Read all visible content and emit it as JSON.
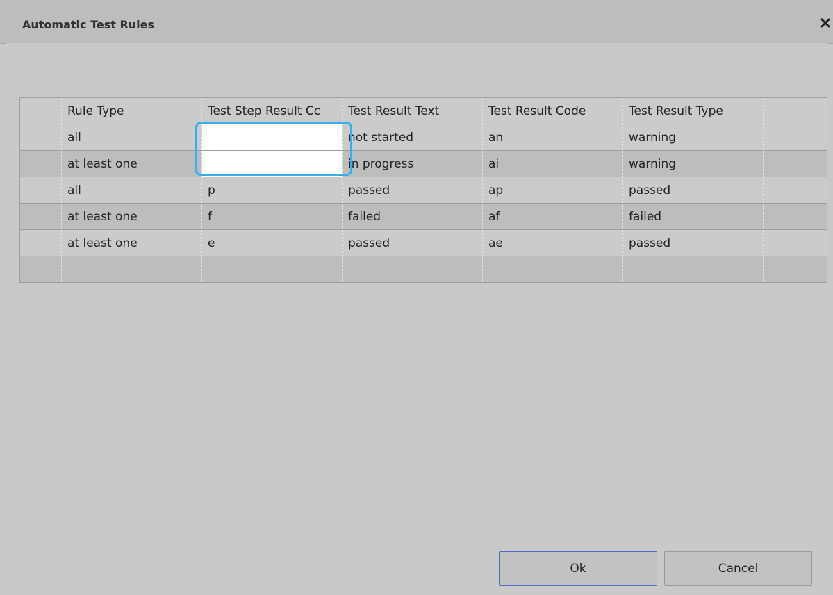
{
  "dialog": {
    "title": "Automatic Test Rules",
    "close_icon": "close-icon"
  },
  "table": {
    "columns": [
      "",
      "Rule Type",
      "Test Step Result Cc",
      "Test Result Text",
      "Test Result Code",
      "Test Result Type",
      ""
    ],
    "rows": [
      [
        "",
        "all",
        "",
        "not started",
        "an",
        "warning",
        ""
      ],
      [
        "",
        "at least one",
        "",
        "in progress",
        "ai",
        "warning",
        ""
      ],
      [
        "",
        "all",
        "p",
        "passed",
        "ap",
        "passed",
        ""
      ],
      [
        "",
        "at least one",
        "f",
        "failed",
        "af",
        "failed",
        ""
      ],
      [
        "",
        "at least one",
        "e",
        "passed",
        "ae",
        "passed",
        ""
      ],
      [
        "",
        "",
        "",
        "",
        "",
        "",
        ""
      ]
    ]
  },
  "footer": {
    "ok_label": "Ok",
    "cancel_label": "Cancel"
  },
  "colors": {
    "focus_border": "#35b0e8",
    "ok_border": "#4a6fc2"
  }
}
